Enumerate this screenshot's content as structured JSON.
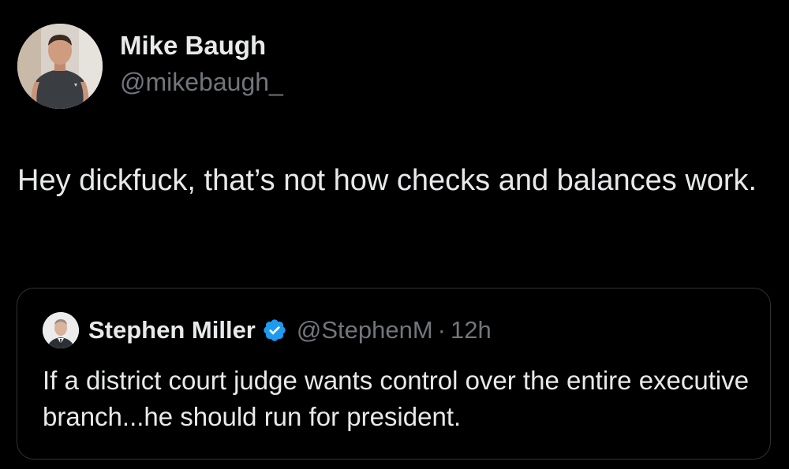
{
  "author": {
    "display_name": "Mike Baugh",
    "handle": "@mikebaugh_",
    "avatar_icon": "profile-photo-avatar"
  },
  "tweet": {
    "text": "Hey dickfuck, that’s not how checks and balances work."
  },
  "quoted_tweet": {
    "display_name": "Stephen Miller",
    "verified": true,
    "verified_icon": "verified-badge-icon",
    "handle": "@StephenM",
    "separator": "·",
    "time": "12h",
    "text": "If a district court judge wants control over the entire executive branch...he should run for president."
  },
  "colors": {
    "background": "#000000",
    "primary_text": "#e7e9ea",
    "secondary_text": "#71767b",
    "border": "#2f3336",
    "verified_blue": "#1d9bf0"
  }
}
